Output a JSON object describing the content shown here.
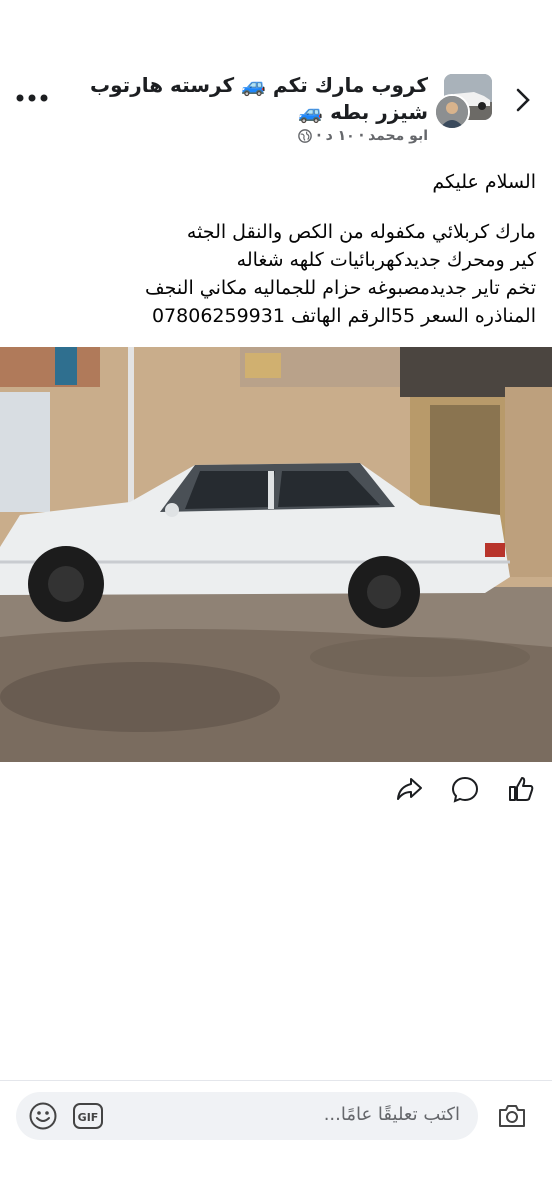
{
  "header": {
    "group_name": "كروب مارك تكم 🚙 كرسته  هارتوب شيزر بطه 🚙",
    "author": "ابو محمد",
    "time": "١٠ د",
    "icons": {
      "more": "more-dots-icon",
      "back": "chevron-right-icon",
      "audience": "globe-icon"
    }
  },
  "post": {
    "greeting": "السلام عليكم",
    "lines": [
      "مارك كربلائي مكفوله من الكص والنقل الجثه",
      "كير ومحرك جديدكهربائيات كلهه  شغاله",
      "تخم تاير جديدمصبوغه حزام للجماليه مكاني النجف",
      "المناذره السعر 55الرقم الهاتف 07806259931"
    ]
  },
  "actions": {
    "icons": [
      "like-icon",
      "comment-icon",
      "share-icon"
    ]
  },
  "comment": {
    "placeholder": "اكتب تعليقًا عامًا...",
    "gif_label": "GIF",
    "icons": [
      "camera-icon",
      "emoji-icon",
      "gif-icon"
    ]
  },
  "colors": {
    "accent": "#1877f2",
    "muted": "#65676b",
    "car": "#e8eaec",
    "wall": "#c9ad8b"
  }
}
